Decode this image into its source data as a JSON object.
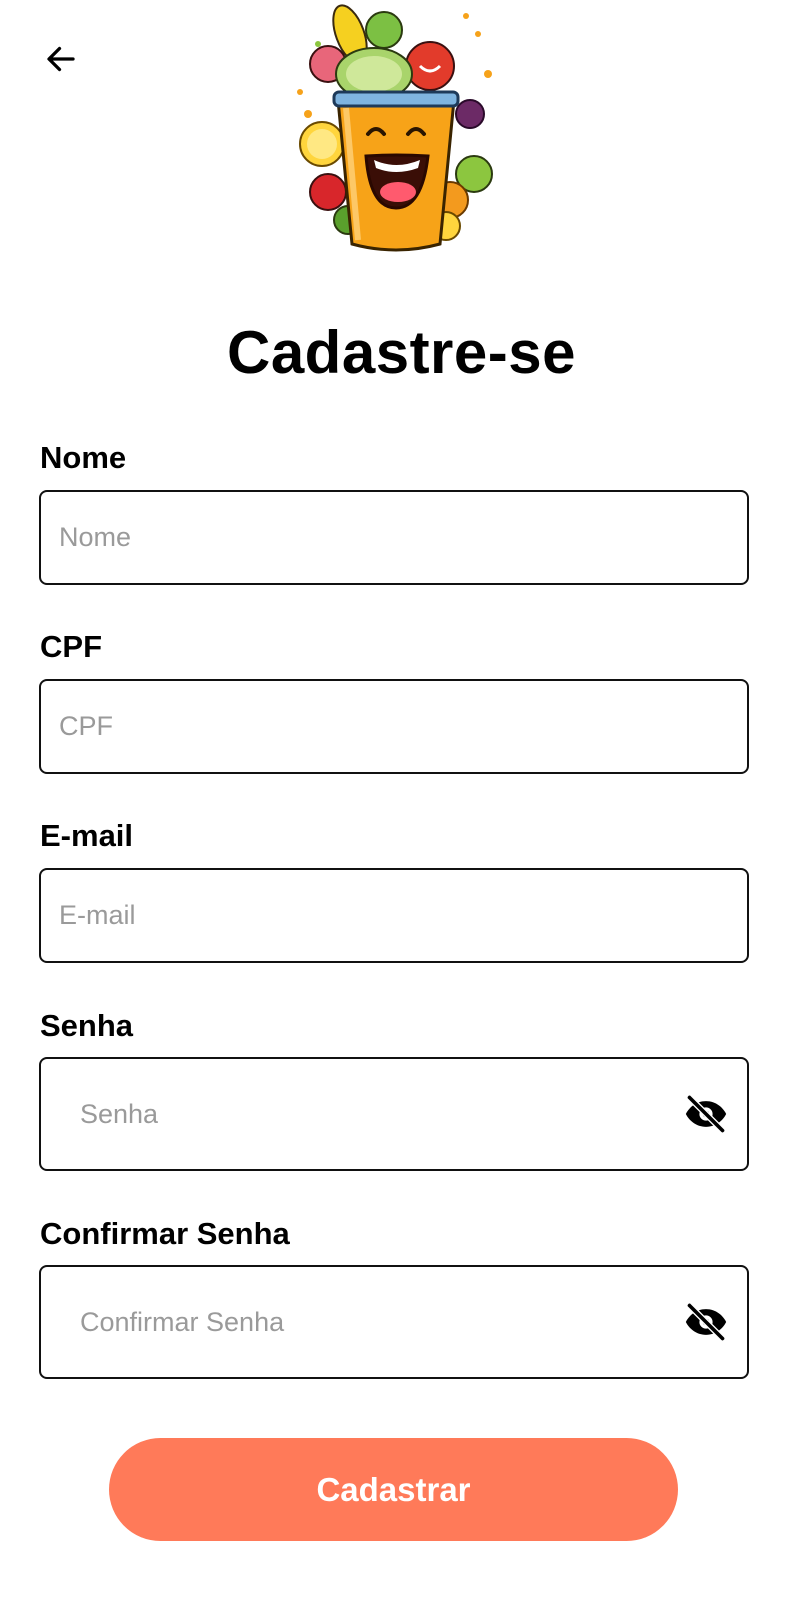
{
  "header": {
    "back_icon": "arrow-left-icon",
    "logo_icon": "juice-cup-mascot-logo"
  },
  "title": "Cadastre-se",
  "form": {
    "nome": {
      "label": "Nome",
      "placeholder": "Nome",
      "value": ""
    },
    "cpf": {
      "label": "CPF",
      "placeholder": "CPF",
      "value": ""
    },
    "email": {
      "label": "E-mail",
      "placeholder": "E-mail",
      "value": ""
    },
    "senha": {
      "label": "Senha",
      "placeholder": "Senha",
      "value": "",
      "toggle_icon": "eye-off-icon"
    },
    "confirmar_senha": {
      "label": "Confirmar Senha",
      "placeholder": "Confirmar Senha",
      "value": "",
      "toggle_icon": "eye-off-icon"
    }
  },
  "submit_label": "Cadastrar",
  "colors": {
    "primary_button": "#ff7a59",
    "text": "#000000",
    "placeholder": "#9a9a9a",
    "border": "#111111"
  }
}
